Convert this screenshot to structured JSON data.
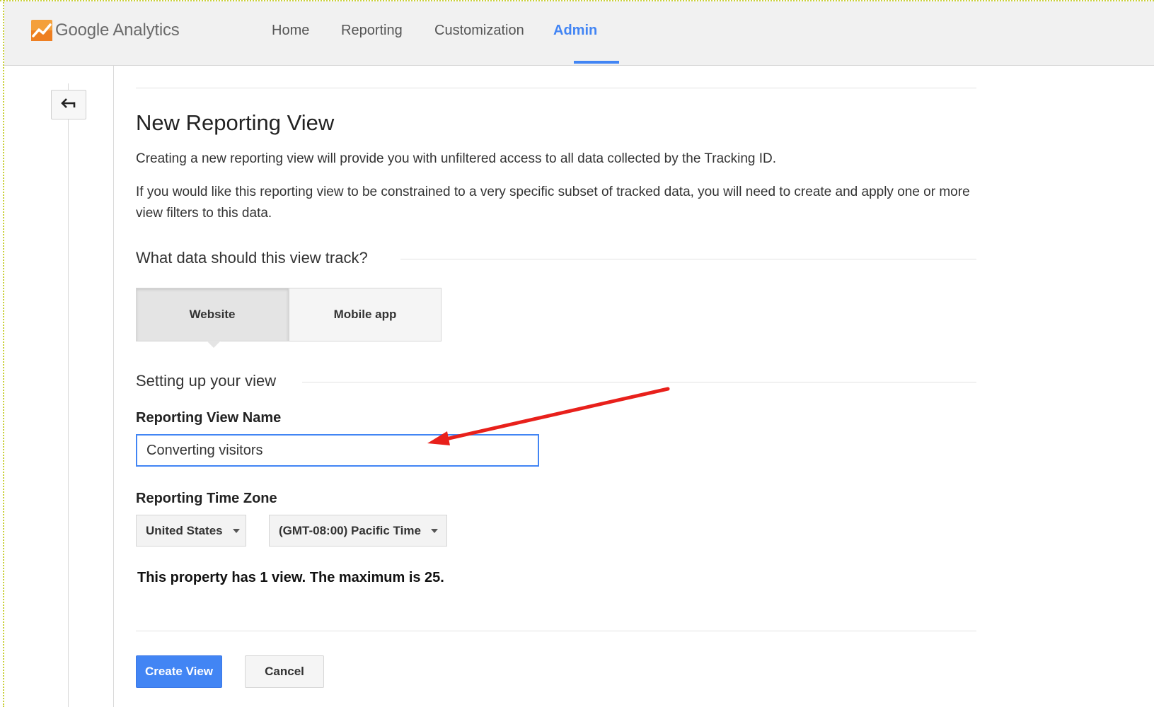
{
  "app": {
    "brand": "Google Analytics",
    "accent_color": "#4285f4"
  },
  "nav": {
    "items": [
      {
        "label": "Home"
      },
      {
        "label": "Reporting"
      },
      {
        "label": "Customization"
      },
      {
        "label": "Admin",
        "active": true
      }
    ]
  },
  "page": {
    "title": "New Reporting View",
    "intro": "Creating a new reporting view will provide you with unfiltered access to all data collected by the Tracking ID.",
    "filters_note": "If you would like this reporting view to be constrained to a very specific subset of tracked data, you will need to create and apply one or more view filters to this data."
  },
  "track_section": {
    "heading": "What data should this view track?",
    "options": [
      {
        "label": "Website",
        "selected": true
      },
      {
        "label": "Mobile app",
        "selected": false
      }
    ]
  },
  "setup_section": {
    "heading": "Setting up your view",
    "view_name_label": "Reporting View Name",
    "view_name_value": "Converting visitors",
    "time_zone_label": "Reporting Time Zone",
    "country_value": "United States",
    "timezone_value": "(GMT-08:00) Pacific Time"
  },
  "limits_note": "This property has 1 view. The maximum is 25.",
  "actions": {
    "create_label": "Create View",
    "cancel_label": "Cancel"
  },
  "icons": {
    "back": "back-arrow-icon",
    "logo": "google-analytics-logo-icon",
    "annotation": "red-arrow-annotation"
  }
}
